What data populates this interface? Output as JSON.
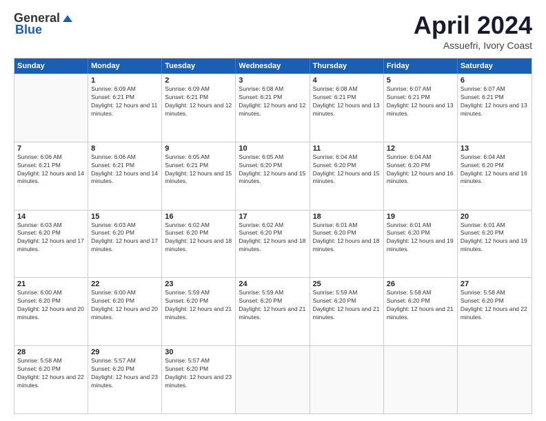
{
  "header": {
    "logo_general": "General",
    "logo_blue": "Blue",
    "month_title": "April 2024",
    "location": "Assuefri, Ivory Coast"
  },
  "weekdays": [
    "Sunday",
    "Monday",
    "Tuesday",
    "Wednesday",
    "Thursday",
    "Friday",
    "Saturday"
  ],
  "rows": [
    [
      {
        "day": "",
        "sunrise": "",
        "sunset": "",
        "daylight": ""
      },
      {
        "day": "1",
        "sunrise": "Sunrise: 6:09 AM",
        "sunset": "Sunset: 6:21 PM",
        "daylight": "Daylight: 12 hours and 11 minutes."
      },
      {
        "day": "2",
        "sunrise": "Sunrise: 6:09 AM",
        "sunset": "Sunset: 6:21 PM",
        "daylight": "Daylight: 12 hours and 12 minutes."
      },
      {
        "day": "3",
        "sunrise": "Sunrise: 6:08 AM",
        "sunset": "Sunset: 6:21 PM",
        "daylight": "Daylight: 12 hours and 12 minutes."
      },
      {
        "day": "4",
        "sunrise": "Sunrise: 6:08 AM",
        "sunset": "Sunset: 6:21 PM",
        "daylight": "Daylight: 12 hours and 13 minutes."
      },
      {
        "day": "5",
        "sunrise": "Sunrise: 6:07 AM",
        "sunset": "Sunset: 6:21 PM",
        "daylight": "Daylight: 12 hours and 13 minutes."
      },
      {
        "day": "6",
        "sunrise": "Sunrise: 6:07 AM",
        "sunset": "Sunset: 6:21 PM",
        "daylight": "Daylight: 12 hours and 13 minutes."
      }
    ],
    [
      {
        "day": "7",
        "sunrise": "Sunrise: 6:06 AM",
        "sunset": "Sunset: 6:21 PM",
        "daylight": "Daylight: 12 hours and 14 minutes."
      },
      {
        "day": "8",
        "sunrise": "Sunrise: 6:06 AM",
        "sunset": "Sunset: 6:21 PM",
        "daylight": "Daylight: 12 hours and 14 minutes."
      },
      {
        "day": "9",
        "sunrise": "Sunrise: 6:05 AM",
        "sunset": "Sunset: 6:21 PM",
        "daylight": "Daylight: 12 hours and 15 minutes."
      },
      {
        "day": "10",
        "sunrise": "Sunrise: 6:05 AM",
        "sunset": "Sunset: 6:20 PM",
        "daylight": "Daylight: 12 hours and 15 minutes."
      },
      {
        "day": "11",
        "sunrise": "Sunrise: 6:04 AM",
        "sunset": "Sunset: 6:20 PM",
        "daylight": "Daylight: 12 hours and 15 minutes."
      },
      {
        "day": "12",
        "sunrise": "Sunrise: 6:04 AM",
        "sunset": "Sunset: 6:20 PM",
        "daylight": "Daylight: 12 hours and 16 minutes."
      },
      {
        "day": "13",
        "sunrise": "Sunrise: 6:04 AM",
        "sunset": "Sunset: 6:20 PM",
        "daylight": "Daylight: 12 hours and 16 minutes."
      }
    ],
    [
      {
        "day": "14",
        "sunrise": "Sunrise: 6:03 AM",
        "sunset": "Sunset: 6:20 PM",
        "daylight": "Daylight: 12 hours and 17 minutes."
      },
      {
        "day": "15",
        "sunrise": "Sunrise: 6:03 AM",
        "sunset": "Sunset: 6:20 PM",
        "daylight": "Daylight: 12 hours and 17 minutes."
      },
      {
        "day": "16",
        "sunrise": "Sunrise: 6:02 AM",
        "sunset": "Sunset: 6:20 PM",
        "daylight": "Daylight: 12 hours and 18 minutes."
      },
      {
        "day": "17",
        "sunrise": "Sunrise: 6:02 AM",
        "sunset": "Sunset: 6:20 PM",
        "daylight": "Daylight: 12 hours and 18 minutes."
      },
      {
        "day": "18",
        "sunrise": "Sunrise: 6:01 AM",
        "sunset": "Sunset: 6:20 PM",
        "daylight": "Daylight: 12 hours and 18 minutes."
      },
      {
        "day": "19",
        "sunrise": "Sunrise: 6:01 AM",
        "sunset": "Sunset: 6:20 PM",
        "daylight": "Daylight: 12 hours and 19 minutes."
      },
      {
        "day": "20",
        "sunrise": "Sunrise: 6:01 AM",
        "sunset": "Sunset: 6:20 PM",
        "daylight": "Daylight: 12 hours and 19 minutes."
      }
    ],
    [
      {
        "day": "21",
        "sunrise": "Sunrise: 6:00 AM",
        "sunset": "Sunset: 6:20 PM",
        "daylight": "Daylight: 12 hours and 20 minutes."
      },
      {
        "day": "22",
        "sunrise": "Sunrise: 6:00 AM",
        "sunset": "Sunset: 6:20 PM",
        "daylight": "Daylight: 12 hours and 20 minutes."
      },
      {
        "day": "23",
        "sunrise": "Sunrise: 5:59 AM",
        "sunset": "Sunset: 6:20 PM",
        "daylight": "Daylight: 12 hours and 21 minutes."
      },
      {
        "day": "24",
        "sunrise": "Sunrise: 5:59 AM",
        "sunset": "Sunset: 6:20 PM",
        "daylight": "Daylight: 12 hours and 21 minutes."
      },
      {
        "day": "25",
        "sunrise": "Sunrise: 5:59 AM",
        "sunset": "Sunset: 6:20 PM",
        "daylight": "Daylight: 12 hours and 21 minutes."
      },
      {
        "day": "26",
        "sunrise": "Sunrise: 5:58 AM",
        "sunset": "Sunset: 6:20 PM",
        "daylight": "Daylight: 12 hours and 21 minutes."
      },
      {
        "day": "27",
        "sunrise": "Sunrise: 5:58 AM",
        "sunset": "Sunset: 6:20 PM",
        "daylight": "Daylight: 12 hours and 22 minutes."
      }
    ],
    [
      {
        "day": "28",
        "sunrise": "Sunrise: 5:58 AM",
        "sunset": "Sunset: 6:20 PM",
        "daylight": "Daylight: 12 hours and 22 minutes."
      },
      {
        "day": "29",
        "sunrise": "Sunrise: 5:57 AM",
        "sunset": "Sunset: 6:20 PM",
        "daylight": "Daylight: 12 hours and 23 minutes."
      },
      {
        "day": "30",
        "sunrise": "Sunrise: 5:57 AM",
        "sunset": "Sunset: 6:20 PM",
        "daylight": "Daylight: 12 hours and 23 minutes."
      },
      {
        "day": "",
        "sunrise": "",
        "sunset": "",
        "daylight": ""
      },
      {
        "day": "",
        "sunrise": "",
        "sunset": "",
        "daylight": ""
      },
      {
        "day": "",
        "sunrise": "",
        "sunset": "",
        "daylight": ""
      },
      {
        "day": "",
        "sunrise": "",
        "sunset": "",
        "daylight": ""
      }
    ]
  ]
}
